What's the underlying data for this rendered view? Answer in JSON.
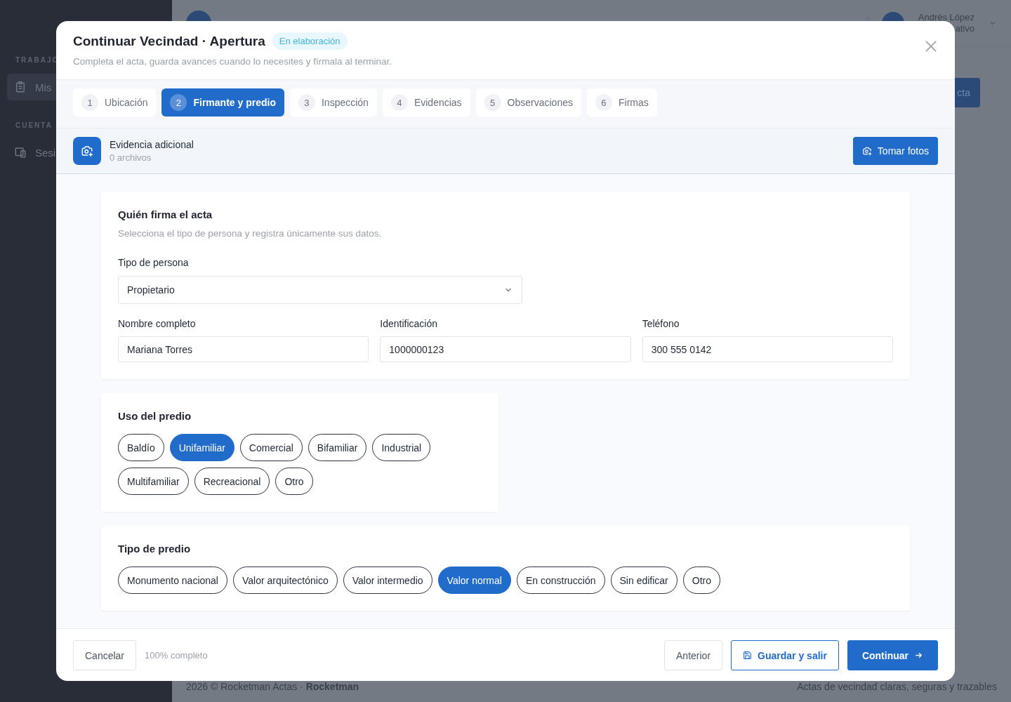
{
  "background": {
    "sidebar": [
      {
        "section": "TRABAJO",
        "items": [
          {
            "label": "Mis",
            "selected": true
          }
        ]
      },
      {
        "section": "CUENTA",
        "items": [
          {
            "label": "Sesi",
            "selected": false
          }
        ]
      }
    ],
    "user": {
      "name": "Andrés López",
      "role": "ativo"
    },
    "action_button": "cta",
    "footer": {
      "left": "2026 © Rocketman Actas · **Rocketman**",
      "right": "Actas de vecindad claras, seguras y trazables"
    }
  },
  "modal": {
    "title": "Continuar Vecindad · Apertura",
    "status": "En elaboración",
    "subtitle": "Completa el acta, guarda avances cuando lo necesites y fírmala al terminar.",
    "steps": [
      {
        "number": "1",
        "label": "Ubicación",
        "selected": false
      },
      {
        "number": "2",
        "label": "Firmante y predio",
        "selected": true
      },
      {
        "number": "3",
        "label": "Inspección",
        "selected": false
      },
      {
        "number": "4",
        "label": "Evidencias",
        "selected": false
      },
      {
        "number": "5",
        "label": "Observaciones",
        "selected": false
      },
      {
        "number": "6",
        "label": "Firmas",
        "selected": false
      }
    ],
    "evidence": {
      "title": "Evidencia adicional",
      "count": "0 archivos",
      "button": "Tomar fotos"
    },
    "signer": {
      "title": "Quién firma el acta",
      "subtitle": "Selecciona el tipo de persona y registra únicamente sus datos.",
      "person_type": {
        "label": "Tipo de persona",
        "value": "Propietario"
      },
      "fields": [
        {
          "label": "Nombre completo",
          "value": "Mariana Torres"
        },
        {
          "label": "Identificación",
          "value": "1000000123"
        },
        {
          "label": "Teléfono",
          "value": "300 555 0142"
        }
      ]
    },
    "usage": {
      "title": "Uso del predio",
      "options": [
        {
          "label": "Baldío",
          "selected": false
        },
        {
          "label": "Unifamiliar",
          "selected": true
        },
        {
          "label": "Comercial",
          "selected": false
        },
        {
          "label": "Bifamiliar",
          "selected": false
        },
        {
          "label": "Industrial",
          "selected": false
        },
        {
          "label": "Multifamiliar",
          "selected": false
        },
        {
          "label": "Recreacional",
          "selected": false
        },
        {
          "label": "Otro",
          "selected": false
        }
      ]
    },
    "property_type": {
      "title": "Tipo de predio",
      "options": [
        {
          "label": "Monumento nacional",
          "selected": false
        },
        {
          "label": "Valor arquitectónico",
          "selected": false
        },
        {
          "label": "Valor intermedio",
          "selected": false
        },
        {
          "label": "Valor normal",
          "selected": true
        },
        {
          "label": "En construcción",
          "selected": false
        },
        {
          "label": "Sin edificar",
          "selected": false
        },
        {
          "label": "Otro",
          "selected": false
        }
      ]
    },
    "footer": {
      "cancel": "Cancelar",
      "progress": "100% completo",
      "previous": "Anterior",
      "save": "Guardar y salir",
      "continue": "Continuar"
    }
  }
}
